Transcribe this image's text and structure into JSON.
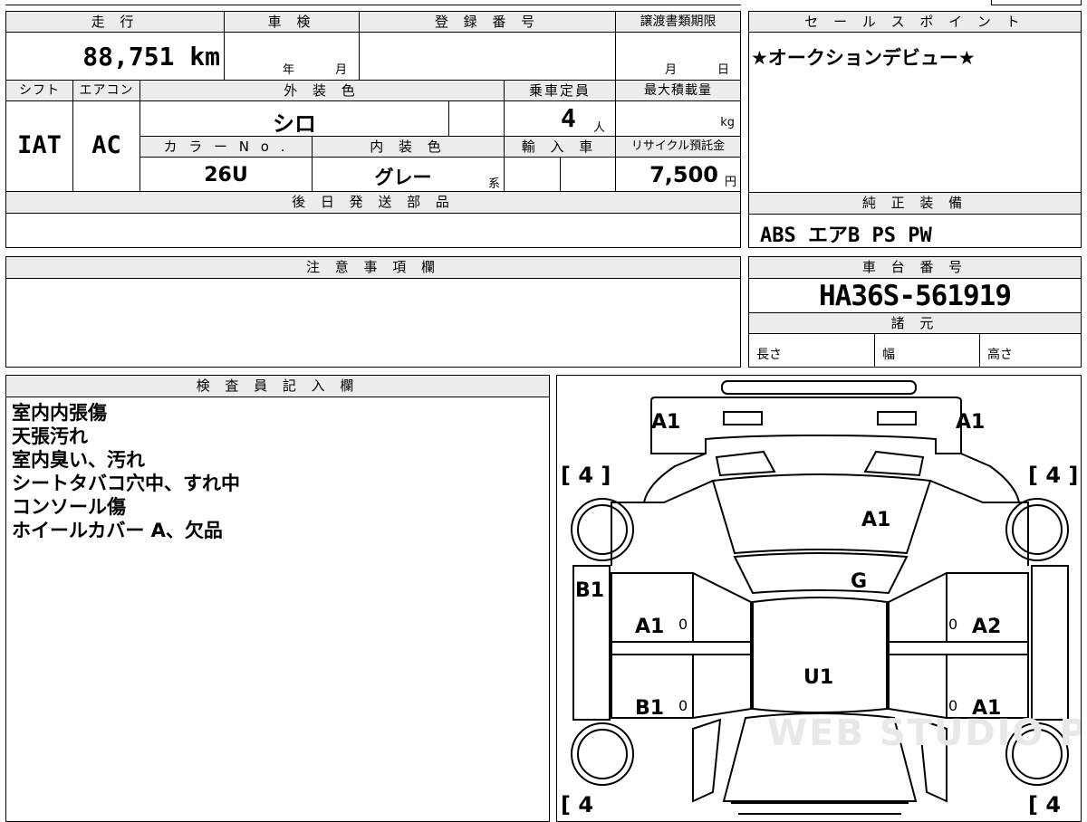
{
  "spec_sheet": {
    "labels": {
      "mileage": "走 行",
      "inspection": "車 検",
      "registration_no": "登 録 番 号",
      "transfer_deadline": "譲渡書類期限",
      "shift": "シフト",
      "aircon": "エアコン",
      "exterior_color": "外 装 色",
      "seating": "乗車定員",
      "max_load": "最大積載量",
      "color_no": "カ ラ ー N o .",
      "interior_color": "内 装 色",
      "imported": "輸 入 車",
      "recycle_fee": "リサイクル預託金",
      "later_parts": "後 日 発 送 部 品",
      "year_unit": "年",
      "month_unit": "月",
      "day_unit": "日",
      "person_unit": "人",
      "kg_unit": "kg",
      "yen_unit": "円",
      "series_unit": "系"
    },
    "values": {
      "mileage": "88,751 km",
      "shift": "IAT",
      "aircon": "AC",
      "exterior_color": "シロ",
      "seating": "4",
      "color_no": "26U",
      "interior_color": "グレー",
      "recycle_fee": "7,500"
    }
  },
  "sales_points": {
    "label": "セ ー ル ス ポ イ ン ト",
    "text": "★オークションデビュー★"
  },
  "standard_equipment": {
    "label": "純 正 装 備",
    "text": "ABS エアB PS PW"
  },
  "notes": {
    "label": "注 意 事 項 欄"
  },
  "chassis": {
    "label": "車 台 番 号",
    "value": "HA36S-561919"
  },
  "specs": {
    "label": "諸 元",
    "length": "長さ",
    "width": "幅",
    "height": "高さ"
  },
  "inspector": {
    "label": "検 査 員 記 入 欄",
    "lines": [
      "室内内張傷",
      "天張汚れ",
      "室内臭い、汚れ",
      "シートタバコ穴中、すれ中",
      "コンソール傷",
      "ホイールカバー A、欠品"
    ]
  },
  "diagram": {
    "tread_top_left": "[ 4 ]",
    "tread_top_right": "[ 4 ]",
    "tread_bottom_left": "[ 4",
    "tread_bottom_right": "[ 4",
    "mark_top_left": "A1",
    "mark_top_right": "A1",
    "mark_windshield": "A1",
    "mark_glass": "G",
    "mark_left_side": "B1",
    "mark_front_left_door": "A1",
    "mark_front_right_door": "A2",
    "mark_roof": "U1",
    "mark_rear_left_door": "B1",
    "mark_rear_right_door": "A1",
    "door_zero": "0",
    "watermark": "WEB STUDIO PRO"
  }
}
